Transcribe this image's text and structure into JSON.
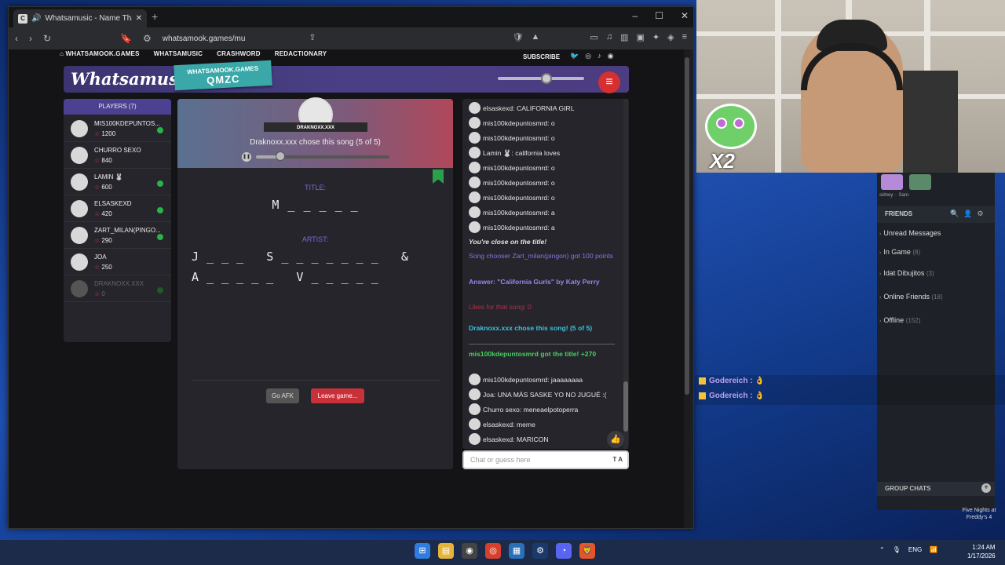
{
  "browser": {
    "tab_title": "Whatsamusic - Name That Tu",
    "new_tab": "+",
    "window_controls": [
      "–",
      "☐",
      "✕"
    ],
    "url": "whatsamook.games/mu"
  },
  "site": {
    "nav": [
      "WHATSAMOOK.GAMES",
      "WHATSAMUSIC",
      "CRASHWORD",
      "REDACTIONARY"
    ],
    "subscribe": "SUBSCRIBE",
    "logo": "Whatsamusic",
    "room_domain": "WHATSAMOOK.GAMES",
    "room_code": "QMZC",
    "volume": 0.55
  },
  "players": {
    "header": "PLAYERS (7)",
    "list": [
      {
        "name": "MIS100KDEPUNTOS...",
        "score": "1200",
        "ready": true
      },
      {
        "name": "CHURRO SEXO",
        "score": "840",
        "ready": false
      },
      {
        "name": "LAMIN 🐰",
        "score": "600",
        "ready": true
      },
      {
        "name": "ELSASKEXD",
        "score": "420",
        "ready": true
      },
      {
        "name": "ZART_MILAN(PINGO...",
        "score": "290",
        "ready": true
      },
      {
        "name": "JOA",
        "score": "250",
        "ready": false
      },
      {
        "name": "DRAKNOXX.XXX",
        "score": "0",
        "ready": true
      }
    ]
  },
  "song": {
    "chooser_tag": "DRAKNOXX.XXX",
    "chose_text": "Draknoxx.xxx chose this song (5 of 5)",
    "progress": 0.19,
    "title_label": "TITLE:",
    "title_hint": "M _ _ _ _ _",
    "artist_label": "ARTIST:",
    "artist_line1": "J _ _ _   S _ _ _ _ _ _ _   &",
    "artist_line2": "A _ _ _ _ _   V _ _ _ _ _",
    "afk_button": "Go AFK",
    "leave_button": "Leave game..."
  },
  "chat": {
    "messages": [
      {
        "type": "u",
        "text": "elsaskexd: CALIFORNIA GIRL"
      },
      {
        "type": "u",
        "text": "mis100kdepuntosmrd: o"
      },
      {
        "type": "u",
        "text": "mis100kdepuntosmrd: o"
      },
      {
        "type": "u",
        "text": "Lamin 🐰: california loves"
      },
      {
        "type": "u",
        "text": "mis100kdepuntosmrd: o"
      },
      {
        "type": "u",
        "text": "mis100kdepuntosmrd: o"
      },
      {
        "type": "u",
        "text": "mis100kdepuntosmrd: o"
      },
      {
        "type": "u",
        "text": "mis100kdepuntosmrd: a"
      },
      {
        "type": "u",
        "text": "mis100kdepuntosmrd: a"
      },
      {
        "type": "sys",
        "text": "You're close on the title!"
      },
      {
        "type": "purple",
        "text": "Song chooser Zart_milan(pingon) got 100 points"
      },
      {
        "type": "purplebold",
        "text": "Answer: \"California Gurls\" by Katy Perry"
      },
      {
        "type": "red",
        "text": "Likes for that song: 0"
      },
      {
        "type": "cyan",
        "text": "Draknoxx.xxx chose this song! (5 of 5)"
      },
      {
        "type": "green",
        "text": "mis100kdepuntosmrd got the title! +270"
      },
      {
        "type": "u",
        "text": "mis100kdepuntosmrd: jaaaaaaaa"
      },
      {
        "type": "u",
        "text": "Joa: UNA MÁS SASKE YO NO JUGUÉ :("
      },
      {
        "type": "u",
        "text": "Churro sexo: meneaelpotoperra"
      },
      {
        "type": "u",
        "text": "elsaskexd: meme"
      },
      {
        "type": "u",
        "text": "elsaskexd: MARICON"
      }
    ],
    "placeholder": "Chat or guess here",
    "input_tag": "T A"
  },
  "overlay": {
    "sticker_text": "X2",
    "friend_names": "sidney ·   ·Sam·",
    "friends_header": "FRIENDS",
    "groups": [
      {
        "label": "Unread Messages",
        "count": ""
      },
      {
        "label": "In Game",
        "count": "(8)"
      },
      {
        "label": "Idat Dibujitos",
        "count": "(3)"
      },
      {
        "label": "Online Friends",
        "count": "(18)"
      },
      {
        "label": "Offline",
        "count": "(152)"
      }
    ],
    "group_chats": "GROUP CHATS",
    "stream_chat": [
      {
        "user": "Godereich",
        "text": "👌"
      },
      {
        "user": "Godereich",
        "text": "👌"
      }
    ],
    "fnaf_label": "Five Nights at Freddy's 4"
  },
  "taskbar": {
    "lang": "ENG",
    "time": "1:24 AM",
    "date": "1/17/2026"
  },
  "colors": {
    "accent_purple": "#4b4190",
    "leave_red": "#c8303a",
    "ready_green": "#2ab34a"
  }
}
